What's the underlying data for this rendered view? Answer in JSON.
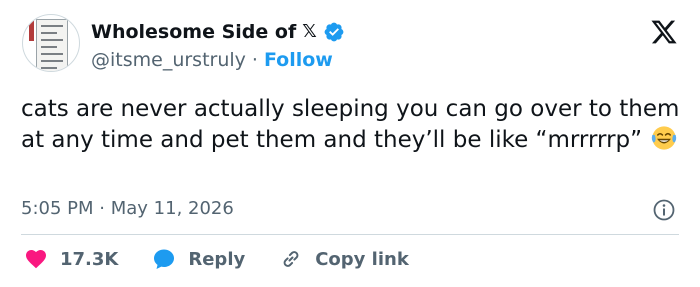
{
  "author": {
    "display_name": "Wholesome Side of",
    "platform_mark": "𝕏",
    "handle": "@itsme_urstruly",
    "separator": "·",
    "follow_label": "Follow"
  },
  "tweet": {
    "text": "cats are never actually sleeping you can go over to them at any time and pet them and they’ll be like “mrrrrrp”",
    "emoji": "face-with-tears-of-joy",
    "time": "5:05 PM",
    "date_separator": "·",
    "date": "May 11, 2026"
  },
  "actions": {
    "likes_count": "17.3K",
    "reply_label": "Reply",
    "copy_link_label": "Copy link"
  },
  "colors": {
    "accent": "#1d9bf0",
    "like": "#f91880",
    "muted": "#536471",
    "text": "#0f1419"
  },
  "icons": [
    "x-logo-icon",
    "verified-badge-icon",
    "info-icon",
    "heart-icon",
    "reply-bubble-icon",
    "link-icon"
  ]
}
